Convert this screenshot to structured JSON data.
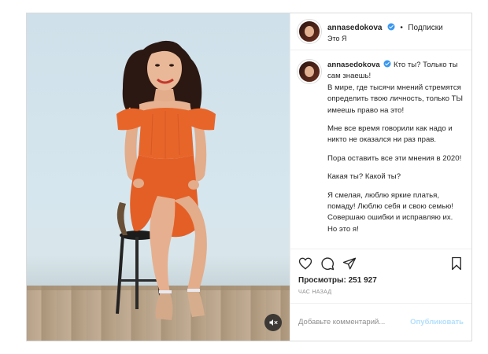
{
  "post": {
    "username": "annasedokova",
    "verified": true,
    "follow_label": "Подписки",
    "dot": "•",
    "location": "Это Я",
    "caption_username": "annasedokova",
    "caption_lines": [
      "Кто ты? Только ты сам знаешь!\nВ мире, где тысячи мнений стремятся определить твою личность, только ТЫ имеешь право на это!",
      "Мне все время говорили как надо и никто не оказался ни раз прав.",
      "Пора оставить все эти мнения в 2020!",
      "Какая ты? Какой ты?",
      "Я смелая, люблю яркие платья, помаду! Люблю себя и свою семью! Совершаю ошибки и исправляю их. Но это я!"
    ],
    "views_label": "Просмотры:",
    "views_count": "251 927",
    "time_ago": "час назад",
    "comment_placeholder": "Добавьте комментарий...",
    "publish_label": "Опубликовать"
  },
  "icons": {
    "like": "heart-icon",
    "comment": "comment-icon",
    "share": "paper-plane-icon",
    "save": "bookmark-icon",
    "mute": "speaker-muted-icon",
    "verified": "verified-badge-icon"
  },
  "colors": {
    "dress": "#e8652a",
    "verified": "#3897f0",
    "publish_disabled": "#b2dffc"
  }
}
